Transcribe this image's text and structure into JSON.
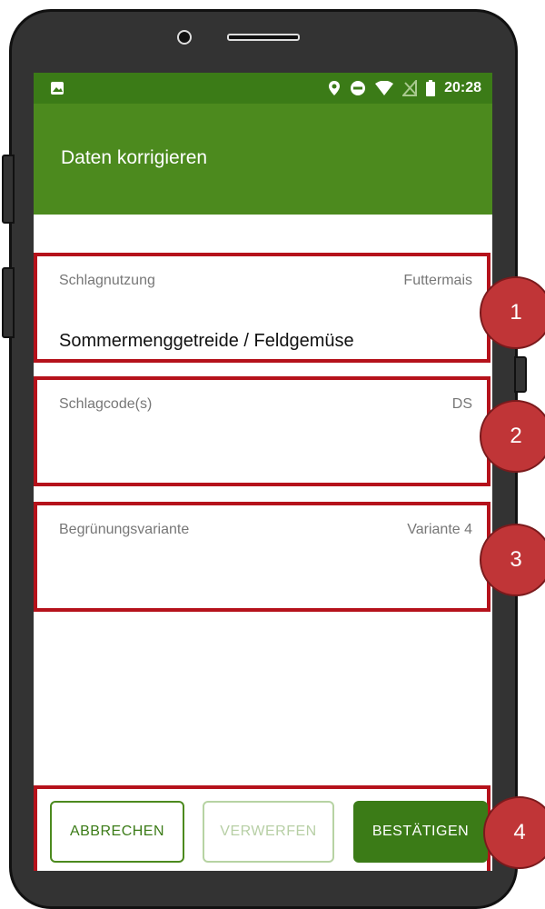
{
  "status_bar": {
    "icons": [
      "image-icon",
      "location-icon",
      "do-not-disturb-icon",
      "wifi-icon",
      "no-sim-icon",
      "battery-icon"
    ],
    "time": "20:28"
  },
  "app_bar": {
    "title": "Daten korrigieren"
  },
  "fields": [
    {
      "label": "Schlagnutzung",
      "hint": "Futtermais",
      "value": "Sommermenggetreide / Feldgemüse"
    },
    {
      "label": "Schlagcode(s)",
      "hint": "DS",
      "value": ""
    },
    {
      "label": "Begrünungsvariante",
      "hint": "Variante 4",
      "value": ""
    }
  ],
  "buttons": {
    "cancel": "ABBRECHEN",
    "discard": "VERWERFEN",
    "confirm": "BESTÄTIGEN"
  },
  "badges": [
    "1",
    "2",
    "3",
    "4"
  ],
  "colors": {
    "primary": "#4c8a1e",
    "status_bar": "#3b7b17",
    "highlight": "#b5121b",
    "badge": "#c03537"
  }
}
